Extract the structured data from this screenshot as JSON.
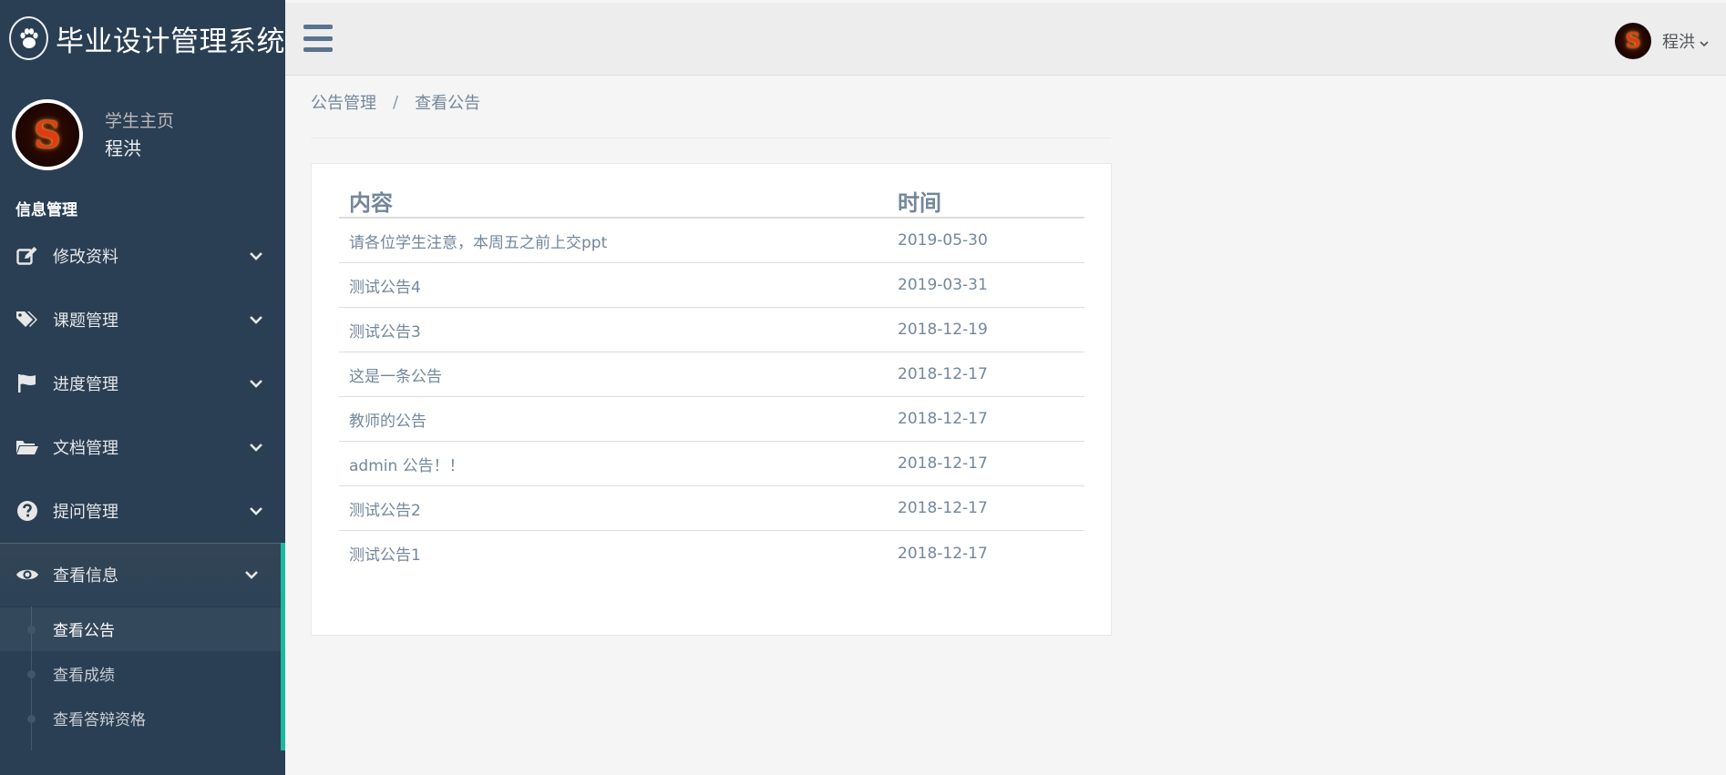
{
  "brand": {
    "title": "毕业设计管理系统",
    "logo_icon": "paw-icon"
  },
  "profile": {
    "welcome": "学生主页",
    "name": "程洪",
    "avatar_letter": "S"
  },
  "menu": {
    "section_title": "信息管理",
    "items": [
      {
        "label": "修改资料",
        "icon": "edit-icon"
      },
      {
        "label": "课题管理",
        "icon": "tags-icon"
      },
      {
        "label": "进度管理",
        "icon": "flag-icon"
      },
      {
        "label": "文档管理",
        "icon": "folder-open-icon"
      },
      {
        "label": "提问管理",
        "icon": "question-circle-icon"
      },
      {
        "label": "查看信息",
        "icon": "eye-icon",
        "active": true
      }
    ],
    "sub_items": [
      {
        "label": "查看公告",
        "current": true
      },
      {
        "label": "查看成绩"
      },
      {
        "label": "查看答辩资格"
      }
    ]
  },
  "topnav": {
    "user_name": "程洪",
    "avatar_letter": "S"
  },
  "breadcrumb": {
    "parent": "公告管理",
    "separator": "/",
    "current": "查看公告"
  },
  "table": {
    "headers": [
      "内容",
      "时间"
    ],
    "rows": [
      [
        "请各位学生注意，本周五之前上交ppt",
        "2019-05-30"
      ],
      [
        "测试公告4",
        "2019-03-31"
      ],
      [
        "测试公告3",
        "2018-12-19"
      ],
      [
        "这是一条公告",
        "2018-12-17"
      ],
      [
        "教师的公告",
        "2018-12-17"
      ],
      [
        "admin 公告！！",
        "2018-12-17"
      ],
      [
        "测试公告2",
        "2018-12-17"
      ],
      [
        "测试公告1",
        "2018-12-17"
      ]
    ]
  },
  "colors": {
    "sidebar_bg": "#2a3f54",
    "accent": "#1abb9c",
    "text": "#73879c",
    "topbar_bg": "#ededed"
  }
}
